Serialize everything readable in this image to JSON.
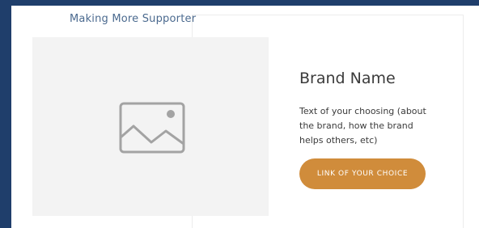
{
  "section": {
    "title": "Making More Supporter"
  },
  "image": {
    "icon": "image-placeholder-icon"
  },
  "brand": {
    "name": "Brand Name",
    "description": "Text of your choosing (about the brand, how the brand helps others, etc)",
    "link_label": "LINK OF YOUR CHOICE"
  },
  "colors": {
    "background": "#1f3e6b",
    "accent": "#d08c3b",
    "placeholder": "#f3f3f3"
  }
}
